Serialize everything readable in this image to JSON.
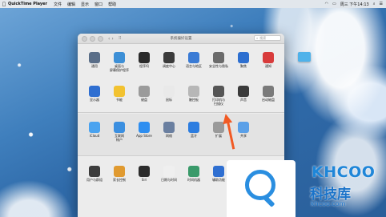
{
  "menubar": {
    "app_name": "QuickTime Player",
    "items": [
      "文件",
      "编辑",
      "显示",
      "窗口",
      "帮助"
    ],
    "clock": "周三 下午14:13"
  },
  "window": {
    "title": "系统偏好设置",
    "search_placeholder": "搜索"
  },
  "section1": [
    {
      "label": "通用",
      "icon": "general-icon",
      "color": "#5a6e88"
    },
    {
      "label": "桌面与\n屏幕保护程序",
      "icon": "desktop-icon",
      "color": "#3d8fd6"
    },
    {
      "label": "程序坞",
      "icon": "dock-icon",
      "color": "#2b2b2b"
    },
    {
      "label": "调度中心",
      "icon": "mission-control-icon",
      "color": "#3b3b3b"
    },
    {
      "label": "语言与地区",
      "icon": "globe-icon",
      "color": "#3a7bd5"
    },
    {
      "label": "安全性与隐私",
      "icon": "house-icon",
      "color": "#6b6b6b"
    },
    {
      "label": "聚焦",
      "icon": "spotlight-icon",
      "color": "#2d6fd0"
    },
    {
      "label": "通知",
      "icon": "notifications-icon",
      "color": "#d83b3b"
    },
    {
      "label": "显示器",
      "icon": "display-icon",
      "color": "#2f6fd1"
    },
    {
      "label": "节能",
      "icon": "bulb-icon",
      "color": "#f2c230"
    },
    {
      "label": "键盘",
      "icon": "keyboard-icon",
      "color": "#9b9b9b"
    },
    {
      "label": "鼠标",
      "icon": "mouse-icon",
      "color": "#e9e9e9"
    },
    {
      "label": "触控板",
      "icon": "trackpad-icon",
      "color": "#b7b7b7"
    },
    {
      "label": "打印机与\n扫描仪",
      "icon": "printer-icon",
      "color": "#555555"
    },
    {
      "label": "声音",
      "icon": "speaker-icon",
      "color": "#3a3a3a"
    },
    {
      "label": "启动磁盘",
      "icon": "disk-icon",
      "color": "#7a7a7a"
    }
  ],
  "section2": [
    {
      "label": "iCloud",
      "icon": "icloud-icon",
      "color": "#4aa3f0"
    },
    {
      "label": "互联网\n帐户",
      "icon": "at-icon",
      "color": "#3b8fe0"
    },
    {
      "label": "App Store",
      "icon": "appstore-icon",
      "color": "#2e8ef0"
    },
    {
      "label": "网络",
      "icon": "network-icon",
      "color": "#6a7fa0"
    },
    {
      "label": "蓝牙",
      "icon": "bluetooth-icon",
      "color": "#2c7de0"
    },
    {
      "label": "扩展",
      "icon": "extensions-icon",
      "color": "#9a9a9a"
    },
    {
      "label": "共享",
      "icon": "sharing-icon",
      "color": "#5aa0e8"
    }
  ],
  "section3": [
    {
      "label": "用户与群组",
      "icon": "users-icon",
      "color": "#3d3d3d"
    },
    {
      "label": "家长控制",
      "icon": "parental-icon",
      "color": "#e09a30"
    },
    {
      "label": "Siri",
      "icon": "siri-icon",
      "color": "#2c2c2c"
    },
    {
      "label": "日期与时间",
      "icon": "clock-icon",
      "color": "#efefef"
    },
    {
      "label": "时间机器",
      "icon": "time-machine-icon",
      "color": "#3a9a6a"
    },
    {
      "label": "辅助功能",
      "icon": "accessibility-icon",
      "color": "#2f6fd1"
    }
  ],
  "watermark": {
    "brand": "KHCOO",
    "brand_cn": "科技库",
    "url": "khcoo.com"
  }
}
